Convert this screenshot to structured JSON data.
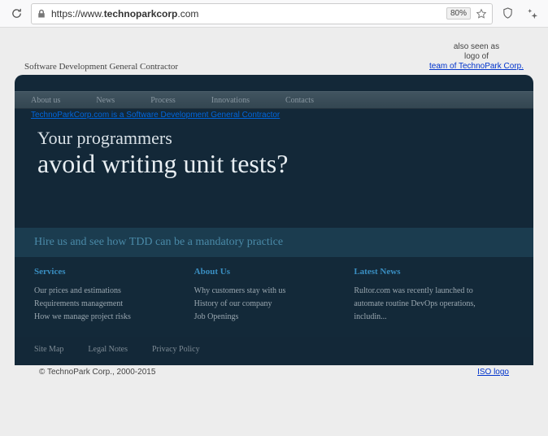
{
  "browser": {
    "url_prefix": "https://www.",
    "url_domain": "technoparkcorp",
    "url_suffix": ".com",
    "zoom": "80%"
  },
  "header": {
    "tagline": "Software Development General Contractor",
    "logo_line1": "also seen as",
    "logo_line2": "logo of",
    "logo_linktext": "team of TechnoPark Corp."
  },
  "nav": {
    "items": [
      "About us",
      "News",
      "Process",
      "Innovations",
      "Contacts"
    ]
  },
  "subtitle": "TechnoParkCorp.com is a Software Development General Contractor",
  "hero": {
    "line1": "Your programmers",
    "line2": "avoid writing unit tests?"
  },
  "cta": "Hire us and see how TDD can be a mandatory practice",
  "columns": {
    "services": {
      "title": "Services",
      "links": [
        "Our prices and estimations",
        "Requirements management",
        "How we manage project risks"
      ]
    },
    "about": {
      "title": "About Us",
      "links": [
        "Why customers stay with us",
        "History of our company",
        "Job Openings"
      ]
    },
    "news": {
      "title": "Latest News",
      "text": "Rultor.com was recently launched to automate routine DevOps operations, includin..."
    }
  },
  "footer": {
    "links": [
      "Site Map",
      "Legal Notes",
      "Privacy Policy"
    ]
  },
  "bottom": {
    "copyright": "© TechnoPark Corp., 2000-2015",
    "iso": "ISO logo"
  }
}
